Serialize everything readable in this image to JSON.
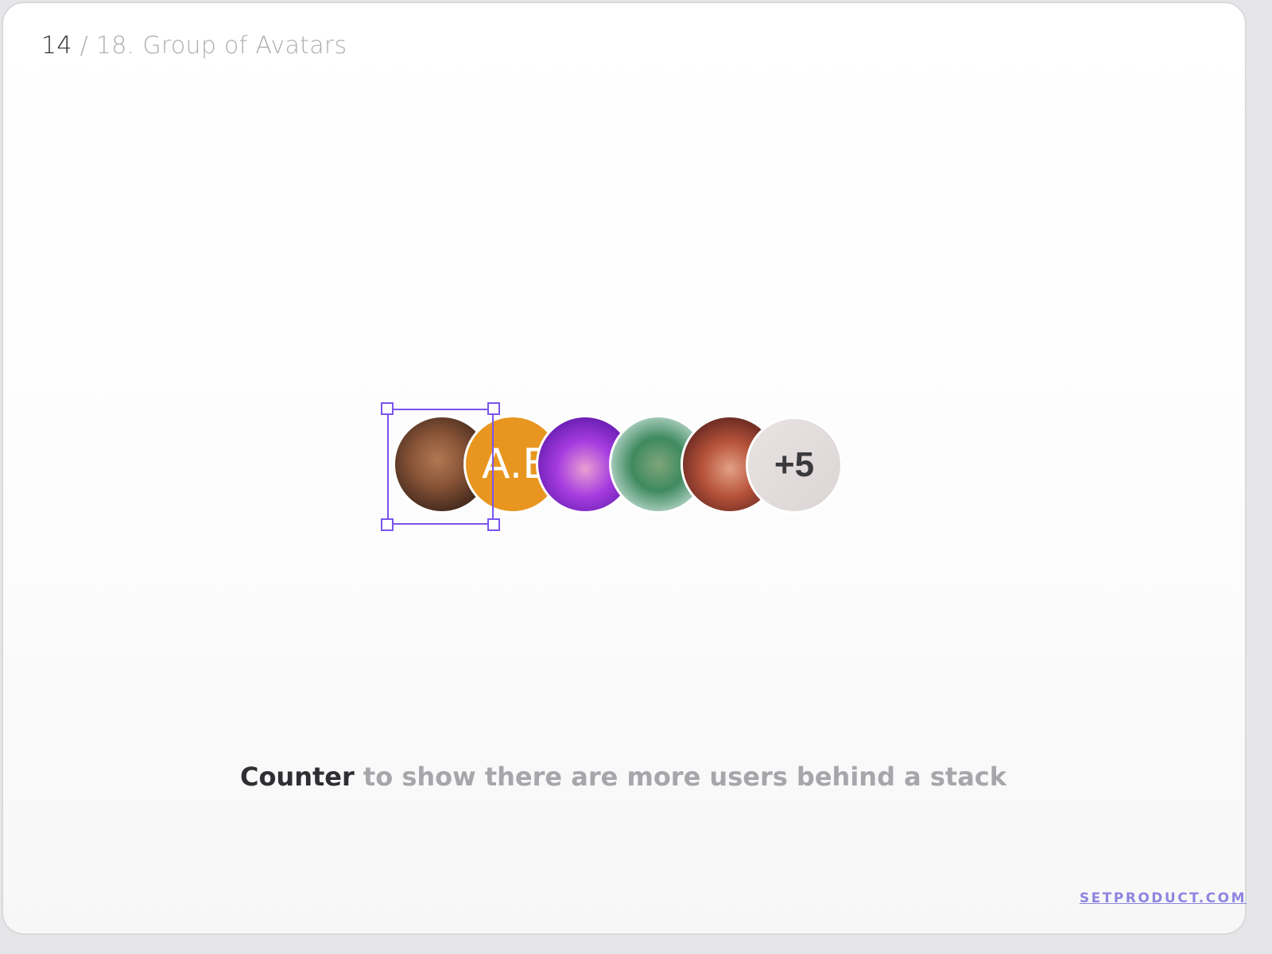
{
  "header": {
    "page_number": "14",
    "separator": "/",
    "title": "18. Group of Avatars"
  },
  "avatars": [
    {
      "name": "photo-avatar-1",
      "kind": "photo"
    },
    {
      "name": "initials-avatar",
      "kind": "initials",
      "initials": "A.B"
    },
    {
      "name": "photo-avatar-2",
      "kind": "photo"
    },
    {
      "name": "photo-avatar-3",
      "kind": "photo"
    },
    {
      "name": "photo-avatar-4",
      "kind": "photo"
    }
  ],
  "counter": {
    "label": "+5"
  },
  "caption": {
    "strong": "Counter",
    "rest": " to show there are more users behind a stack"
  },
  "footer": {
    "link": "SETPRODUCT.COM"
  },
  "colors": {
    "selection": "#7a55ee",
    "initials_bg": "#e8961f",
    "footer_link": "#8f85e0"
  }
}
